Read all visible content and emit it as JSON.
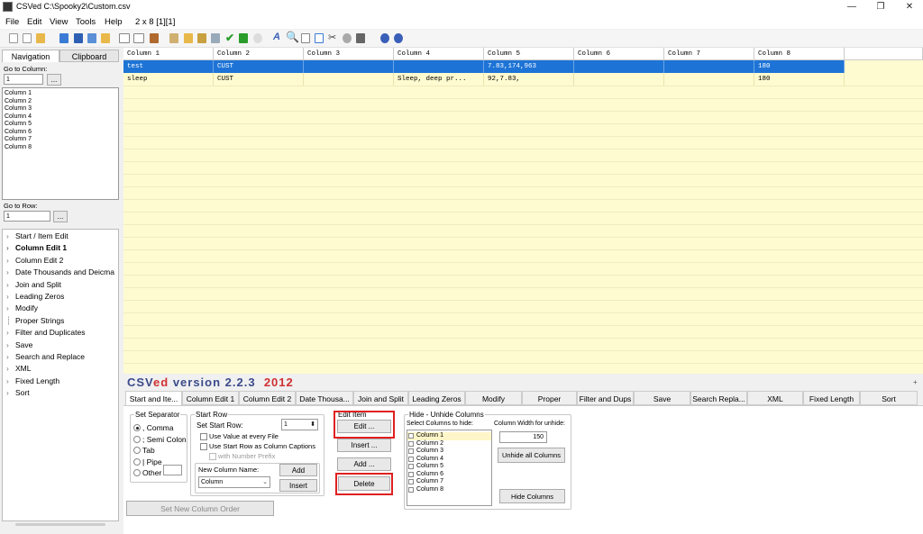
{
  "window": {
    "title": "CSVed C:\\Spooky2\\Custom.csv",
    "minimize": "—",
    "maximize": "❐",
    "close": "✕"
  },
  "menu": {
    "items": [
      "File",
      "Edit",
      "View",
      "Tools",
      "Help"
    ],
    "status": "2 x 8 [1][1]"
  },
  "left": {
    "tabs": [
      "Navigation",
      "Clipboard"
    ],
    "go_to_column": {
      "label": "Go to Column:",
      "value": "1",
      "button": "..."
    },
    "columns": [
      "Column 1",
      "Column 2",
      "Column 3",
      "Column 4",
      "Column 5",
      "Column 6",
      "Column 7",
      "Column 8"
    ],
    "go_to_row": {
      "label": "Go to Row:",
      "value": "1",
      "button": "..."
    },
    "tree": [
      {
        "label": "Start / Item Edit",
        "bold": false
      },
      {
        "label": "Column Edit 1",
        "bold": true
      },
      {
        "label": "Column Edit 2",
        "bold": false
      },
      {
        "label": "Date Thousands and Deicma",
        "bold": false
      },
      {
        "label": "Join and Split",
        "bold": false
      },
      {
        "label": "Leading Zeros",
        "bold": false
      },
      {
        "label": "Modify",
        "bold": false
      },
      {
        "label": "Proper Strings",
        "bold": false
      },
      {
        "label": "Filter and Duplicates",
        "bold": false
      },
      {
        "label": "Save",
        "bold": false
      },
      {
        "label": "Search and Replace",
        "bold": false
      },
      {
        "label": "XML",
        "bold": false
      },
      {
        "label": "Fixed Length",
        "bold": false
      },
      {
        "label": "Sort",
        "bold": false
      }
    ]
  },
  "grid": {
    "headers": [
      "Column 1",
      "Column 2",
      "Column 3",
      "Column 4",
      "Column 5",
      "Column 6",
      "Column 7",
      "Column 8"
    ],
    "rows": [
      [
        "test",
        "CUST",
        "",
        "",
        "7.83,174,963",
        "",
        "",
        "180"
      ],
      [
        "sleep",
        "CUST",
        "",
        "Sleep, deep pr...",
        "92,7.83,",
        "",
        "",
        "180"
      ]
    ],
    "selected_row": 0,
    "colors": {
      "selected": "#1e74d6",
      "background": "#fefbd0"
    }
  },
  "banner": {
    "name_a": "CSV",
    "name_b": "ed",
    "version": "version 2.2.3",
    "year": "2012",
    "plus": "+"
  },
  "bottom_tabs": [
    "Start and Ite...",
    "Column Edit 1",
    "Column Edit 2",
    "Date Thousa...",
    "Join and Split",
    "Leading Zeros",
    "Modify",
    "Proper",
    "Filter and Dups",
    "Save",
    "Search Repla...",
    "XML",
    "Fixed Length",
    "Sort"
  ],
  "panel": {
    "separator": {
      "title": "Set Separator",
      "options": [
        ", Comma",
        "; Semi Colon",
        "Tab",
        "| Pipe",
        "Other"
      ],
      "selected": 0
    },
    "start_row": {
      "title": "Start Row",
      "set_label": "Set Start Row:",
      "value": "1",
      "use_value": "Use Value at every File",
      "use_captions": "Use Start Row as Column Captions",
      "with_prefix": "with Number Prefix",
      "new_col_label": "New Column Name:",
      "new_col_value": "Column",
      "add": "Add",
      "insert": "Insert"
    },
    "edit_item": {
      "title": "Edit Item",
      "edit": "Edit ...",
      "insert": "Insert ...",
      "add": "Add ...",
      "delete": "Delete"
    },
    "hide": {
      "title": "Hide - Unhide Columns",
      "select_label": "Select Columns to hide:",
      "width_label": "Column Width for unhide:",
      "width_value": "150",
      "unhide_all": "Unhide all Columns",
      "hide_cols": "Hide Columns"
    },
    "set_order": "Set New Column Order"
  }
}
